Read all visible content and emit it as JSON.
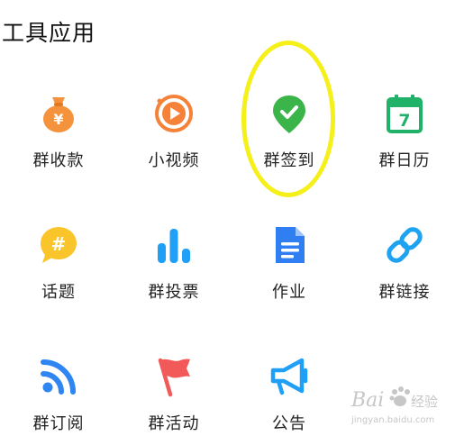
{
  "section": {
    "title": "工具应用"
  },
  "tools": [
    {
      "label": "群收款",
      "icon": "money-bag-icon",
      "color": "#f5933d"
    },
    {
      "label": "小视频",
      "icon": "video-play-icon",
      "color": "#f6823a"
    },
    {
      "label": "群签到",
      "icon": "check-pin-icon",
      "color": "#3bb54a"
    },
    {
      "label": "群日历",
      "icon": "calendar-icon",
      "color": "#20b268",
      "day": "7"
    },
    {
      "label": "话题",
      "icon": "hashtag-bubble-icon",
      "color": "#f9c52a"
    },
    {
      "label": "群投票",
      "icon": "bar-chart-icon",
      "color": "#1f9ff5"
    },
    {
      "label": "作业",
      "icon": "document-icon",
      "color": "#2f7ef2"
    },
    {
      "label": "群链接",
      "icon": "link-icon",
      "color": "#1fa3f0"
    },
    {
      "label": "群订阅",
      "icon": "rss-icon",
      "color": "#2f86f3"
    },
    {
      "label": "群活动",
      "icon": "flag-icon",
      "color": "#f25a5a"
    },
    {
      "label": "公告",
      "icon": "megaphone-icon",
      "color": "#1f9ff5"
    }
  ],
  "watermark": {
    "brand": "Bai",
    "brand_suffix": "经验",
    "url": "jingyan.baidu.com"
  }
}
